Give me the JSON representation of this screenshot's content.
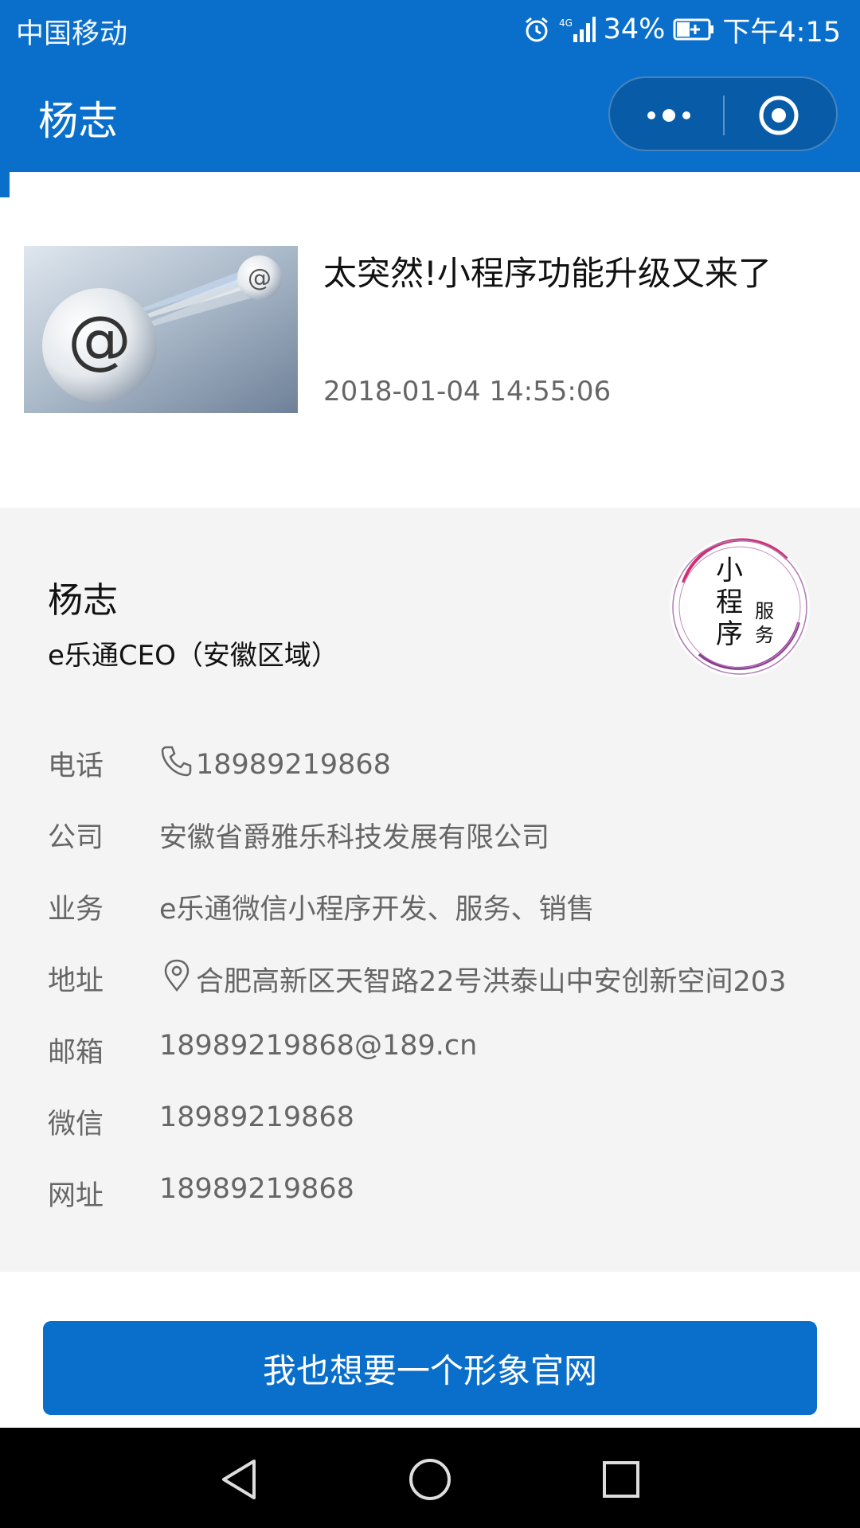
{
  "status_bar": {
    "carrier": "中国移动",
    "network": "4G",
    "battery": "34%",
    "time": "下午4:15",
    "icons": [
      "alarm-icon",
      "signal-icon",
      "battery-icon"
    ]
  },
  "header": {
    "title": "杨志",
    "capsule_icons": [
      "more-icon",
      "close-icon"
    ]
  },
  "news": {
    "title": "太突然!小程序功能升级又来了",
    "date": "2018-01-04 14:55:06",
    "thumbnail": "email-at-spheres-image"
  },
  "card": {
    "name": "杨志",
    "role": "e乐通CEO（安徽区域）",
    "badge": {
      "line1": "小",
      "line2": "程",
      "line3": "序",
      "service1": "服",
      "service2": "务"
    },
    "rows": [
      {
        "label": "电话",
        "value": "18989219868",
        "icon": "phone-icon"
      },
      {
        "label": "公司",
        "value": "安徽省爵雅乐科技发展有限公司"
      },
      {
        "label": "业务",
        "value": "e乐通微信小程序开发、服务、销售"
      },
      {
        "label": "地址",
        "value": "合肥高新区天智路22号洪泰山中安创新空间203",
        "icon": "location-pin-icon"
      },
      {
        "label": "邮箱",
        "value": "18989219868@189.cn"
      },
      {
        "label": "微信",
        "value": "18989219868"
      },
      {
        "label": "网址",
        "value": "18989219868"
      }
    ]
  },
  "cta": {
    "label": "我也想要一个形象官网"
  },
  "nav": {
    "icons": [
      "back-icon",
      "home-icon",
      "recents-icon"
    ]
  },
  "colors": {
    "primary": "#0a6fcb",
    "card_bg": "#f4f4f4",
    "muted_text": "#666666"
  }
}
